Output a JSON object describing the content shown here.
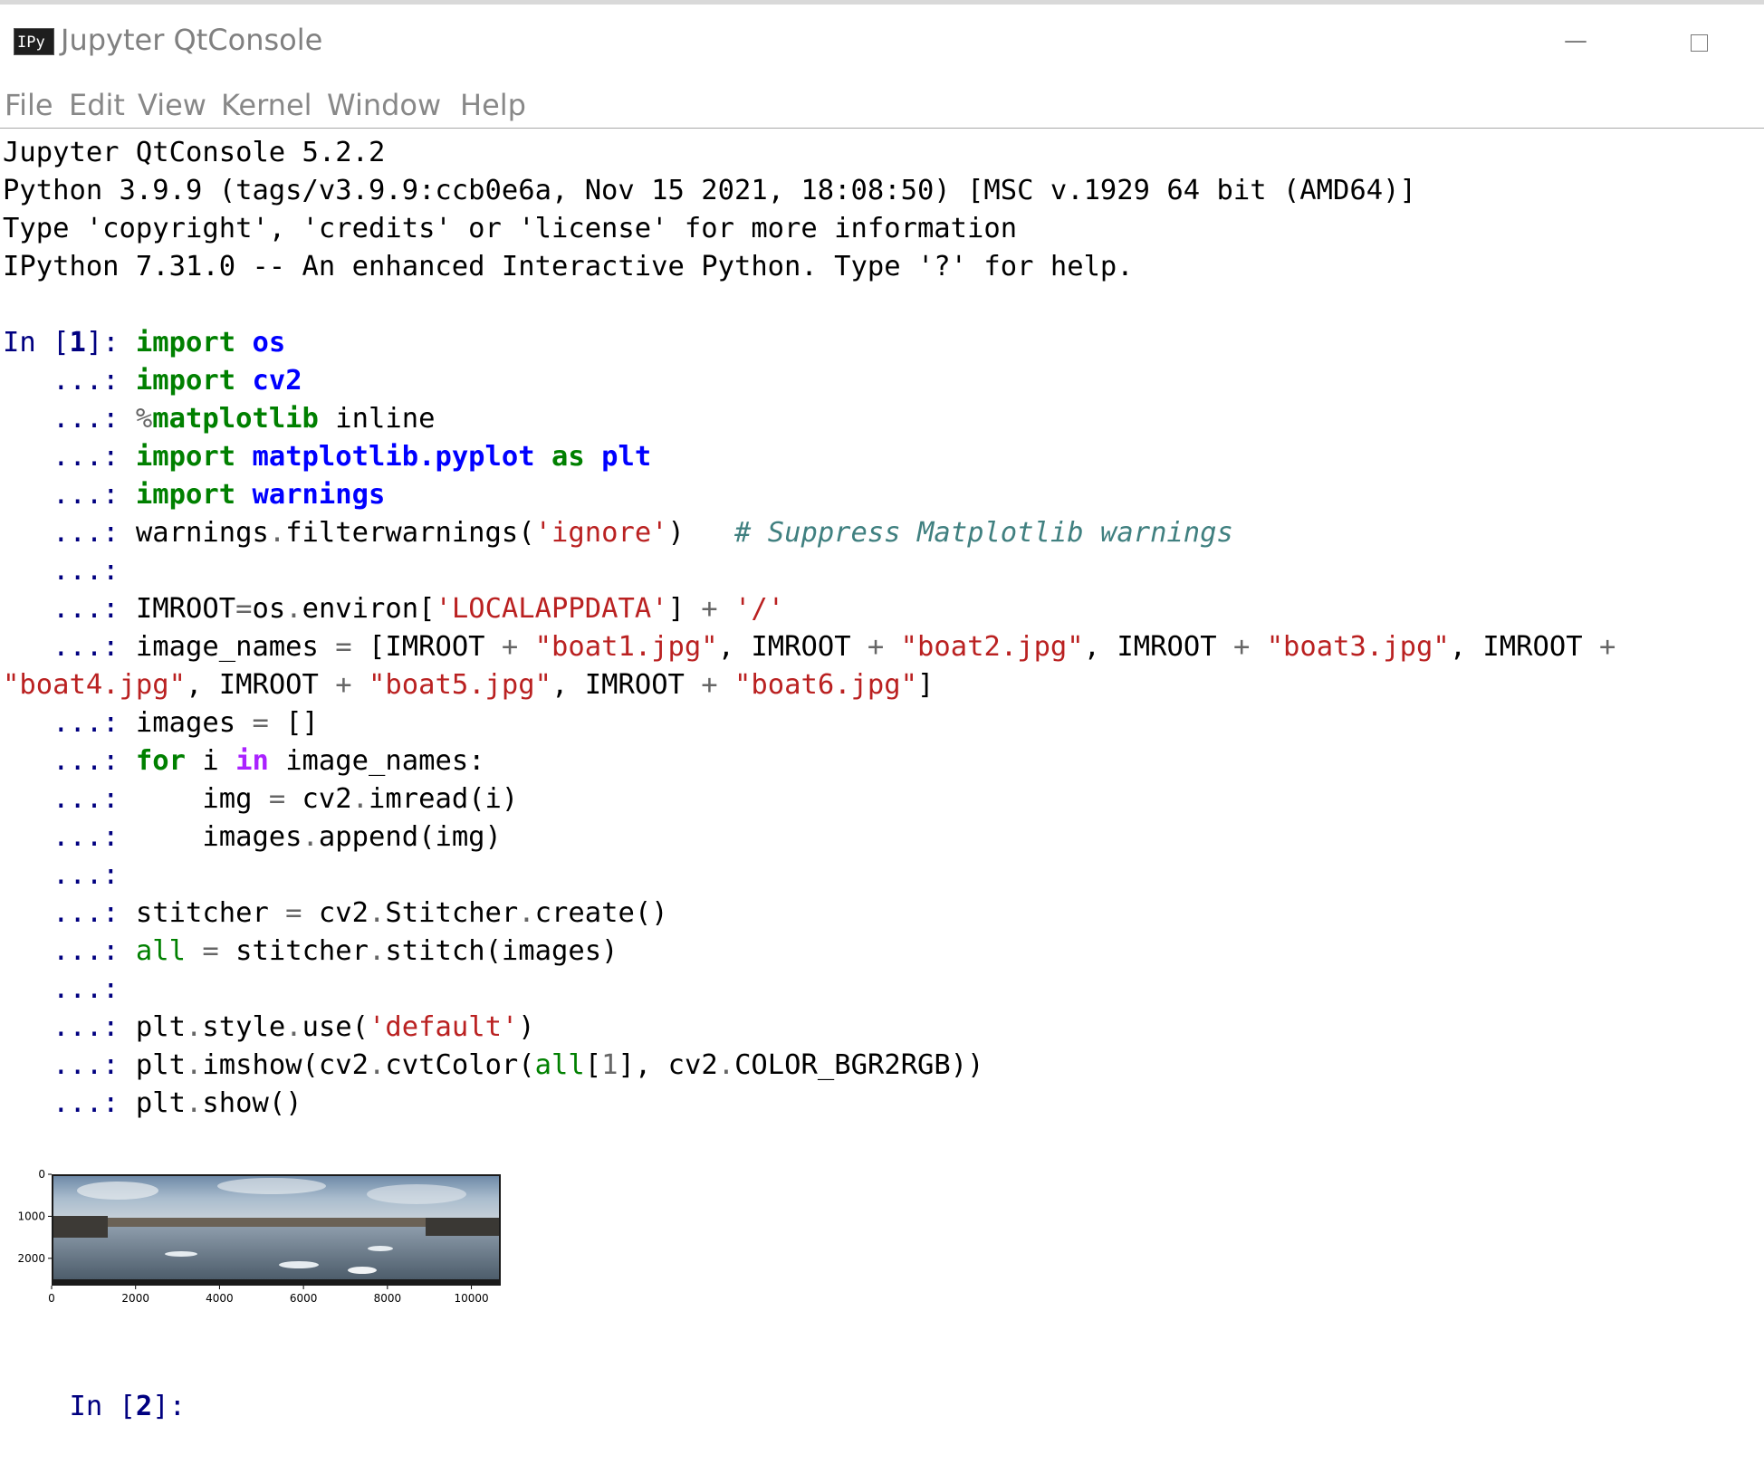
{
  "window": {
    "icon_label": "IPy",
    "title": "Jupyter QtConsole"
  },
  "menu": [
    "File",
    "Edit",
    "View",
    "Kernel",
    "Window",
    "Help"
  ],
  "banner": [
    "Jupyter QtConsole 5.2.2",
    "Python 3.9.9 (tags/v3.9.9:ccb0e6a, Nov 15 2021, 18:08:50) [MSC v.1929 64 bit (AMD64)]",
    "Type 'copyright', 'credits' or 'license' for more information",
    "IPython 7.31.0 -- An enhanced Interactive Python. Type '?' for help."
  ],
  "cell1": {
    "prompt_in": "In [",
    "prompt_num": "1",
    "prompt_close": "]: ",
    "continuation": "   ...: ",
    "lines": [
      [
        {
          "t": "import",
          "c": "kw"
        },
        {
          "t": " "
        },
        {
          "t": "os",
          "c": "nm"
        }
      ],
      [
        {
          "t": "import",
          "c": "kw"
        },
        {
          "t": " "
        },
        {
          "t": "cv2",
          "c": "nm"
        }
      ],
      [
        {
          "t": "%",
          "c": "op"
        },
        {
          "t": "matplotlib",
          "c": "kw"
        },
        {
          "t": " inline"
        }
      ],
      [
        {
          "t": "import",
          "c": "kw"
        },
        {
          "t": " "
        },
        {
          "t": "matplotlib.pyplot",
          "c": "nm"
        },
        {
          "t": " "
        },
        {
          "t": "as",
          "c": "kw"
        },
        {
          "t": " "
        },
        {
          "t": "plt",
          "c": "nm"
        }
      ],
      [
        {
          "t": "import",
          "c": "kw"
        },
        {
          "t": " "
        },
        {
          "t": "warnings",
          "c": "nm"
        }
      ],
      [
        {
          "t": "warnings"
        },
        {
          "t": ".",
          "c": "op"
        },
        {
          "t": "filterwarnings("
        },
        {
          "t": "'ignore'",
          "c": "str"
        },
        {
          "t": ")   "
        },
        {
          "t": "# Suppress Matplotlib warnings",
          "c": "cmt"
        }
      ],
      [],
      [
        {
          "t": "IMROOT"
        },
        {
          "t": "=",
          "c": "op"
        },
        {
          "t": "os"
        },
        {
          "t": ".",
          "c": "op"
        },
        {
          "t": "environ["
        },
        {
          "t": "'LOCALAPPDATA'",
          "c": "str"
        },
        {
          "t": "] "
        },
        {
          "t": "+",
          "c": "op"
        },
        {
          "t": " "
        },
        {
          "t": "'/'",
          "c": "str"
        }
      ],
      [
        {
          "t": "image_names "
        },
        {
          "t": "=",
          "c": "op"
        },
        {
          "t": " [IMROOT "
        },
        {
          "t": "+",
          "c": "op"
        },
        {
          "t": " "
        },
        {
          "t": "\"boat1.jpg\"",
          "c": "str"
        },
        {
          "t": ", IMROOT "
        },
        {
          "t": "+",
          "c": "op"
        },
        {
          "t": " "
        },
        {
          "t": "\"boat2.jpg\"",
          "c": "str"
        },
        {
          "t": ", IMROOT "
        },
        {
          "t": "+",
          "c": "op"
        },
        {
          "t": " "
        },
        {
          "t": "\"boat3.jpg\"",
          "c": "str"
        },
        {
          "t": ", IMROOT "
        },
        {
          "t": "+",
          "c": "op"
        }
      ],
      "WRAP",
      [
        {
          "t": "images "
        },
        {
          "t": "=",
          "c": "op"
        },
        {
          "t": " []"
        }
      ],
      [
        {
          "t": "for",
          "c": "kw"
        },
        {
          "t": " i "
        },
        {
          "t": "in",
          "c": "kw2"
        },
        {
          "t": " image_names:"
        }
      ],
      [
        {
          "t": "    img "
        },
        {
          "t": "=",
          "c": "op"
        },
        {
          "t": " cv2"
        },
        {
          "t": ".",
          "c": "op"
        },
        {
          "t": "imread(i)"
        }
      ],
      [
        {
          "t": "    images"
        },
        {
          "t": ".",
          "c": "op"
        },
        {
          "t": "append(img)"
        }
      ],
      [],
      [
        {
          "t": "stitcher "
        },
        {
          "t": "=",
          "c": "op"
        },
        {
          "t": " cv2"
        },
        {
          "t": ".",
          "c": "op"
        },
        {
          "t": "Stitcher"
        },
        {
          "t": ".",
          "c": "op"
        },
        {
          "t": "create()"
        }
      ],
      [
        {
          "t": "all",
          "c": "bi"
        },
        {
          "t": " "
        },
        {
          "t": "=",
          "c": "op"
        },
        {
          "t": " stitcher"
        },
        {
          "t": ".",
          "c": "op"
        },
        {
          "t": "stitch(images)"
        }
      ],
      [],
      [
        {
          "t": "plt"
        },
        {
          "t": ".",
          "c": "op"
        },
        {
          "t": "style"
        },
        {
          "t": ".",
          "c": "op"
        },
        {
          "t": "use("
        },
        {
          "t": "'default'",
          "c": "str"
        },
        {
          "t": ")"
        }
      ],
      [
        {
          "t": "plt"
        },
        {
          "t": ".",
          "c": "op"
        },
        {
          "t": "imshow(cv2"
        },
        {
          "t": ".",
          "c": "op"
        },
        {
          "t": "cvtColor("
        },
        {
          "t": "all",
          "c": "bi"
        },
        {
          "t": "["
        },
        {
          "t": "1",
          "c": "num"
        },
        {
          "t": "], cv2"
        },
        {
          "t": ".",
          "c": "op"
        },
        {
          "t": "COLOR_BGR2RGB))"
        }
      ],
      [
        {
          "t": "plt"
        },
        {
          "t": ".",
          "c": "op"
        },
        {
          "t": "show()"
        }
      ]
    ],
    "wrap_line": [
      {
        "t": "\"boat4.jpg\"",
        "c": "str"
      },
      {
        "t": ", IMROOT "
      },
      {
        "t": "+",
        "c": "op"
      },
      {
        "t": " "
      },
      {
        "t": "\"boat5.jpg\"",
        "c": "str"
      },
      {
        "t": ", IMROOT "
      },
      {
        "t": "+",
        "c": "op"
      },
      {
        "t": " "
      },
      {
        "t": "\"boat6.jpg\"",
        "c": "str"
      },
      {
        "t": "]"
      }
    ]
  },
  "figure": {
    "y_ticks": [
      "0",
      "1000",
      "2000"
    ],
    "x_ticks": [
      "0",
      "2000",
      "4000",
      "6000",
      "8000",
      "10000"
    ]
  },
  "cell2": {
    "prompt_in": "In [",
    "prompt_num": "2",
    "prompt_close": "]: "
  }
}
